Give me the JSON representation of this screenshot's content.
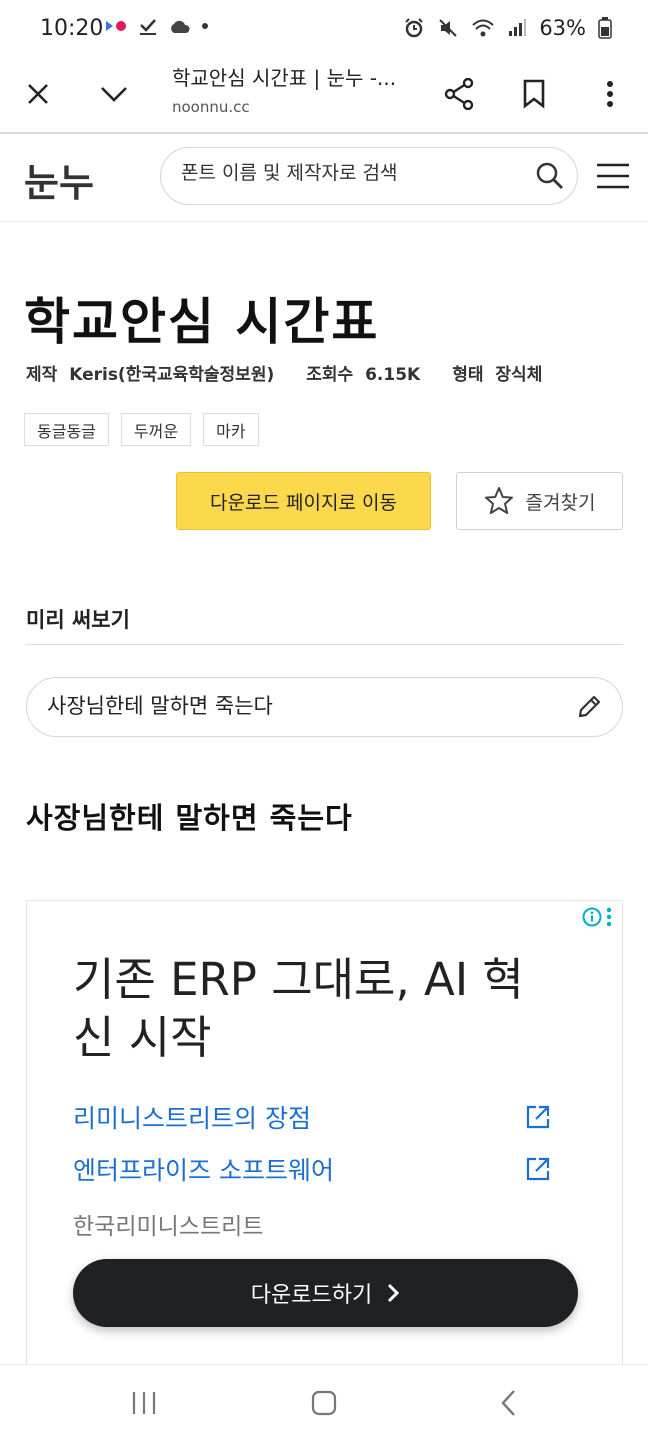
{
  "status_bar": {
    "time": "10:20",
    "battery": "63%",
    "icons": [
      "app-notification-icon",
      "checkmark-icon",
      "cloud-icon",
      "alarm-icon",
      "mute-icon",
      "wifi-icon",
      "signal-icon",
      "battery-icon"
    ]
  },
  "browser": {
    "page_title": "학교안심 시간표 | 눈누 -...",
    "url": "noonnu.cc"
  },
  "site": {
    "logo": "눈누",
    "search_placeholder": "폰트 이름 및 제작자로 검색"
  },
  "font": {
    "title": "학교안심 시간표",
    "maker_label": "제작",
    "maker": "Keris(한국교육학술정보원)",
    "views_label": "조회수",
    "views": "6.15K",
    "style_label": "형태",
    "style": "장식체",
    "tags": [
      "동글동글",
      "두꺼운",
      "마카"
    ],
    "download_label": "다운로드 페이지로 이동",
    "favorite_label": "즐겨찾기"
  },
  "preview": {
    "heading": "미리 써보기",
    "input_value": "사장님한테 말하면 죽는다",
    "rendered_text": "사장님한테 말하면 죽는다"
  },
  "ad": {
    "headline": "기존 ERP 그대로, AI 혁신 시작",
    "link1": "리미니스트리트의 장점",
    "link2": "엔터프라이즈 소프트웨어",
    "advertiser": "한국리미니스트리트",
    "cta": "다운로드하기",
    "accent_color": "#1a6fd1"
  },
  "colors": {
    "download_button": "#fcd84d",
    "cta_button": "#202124"
  }
}
